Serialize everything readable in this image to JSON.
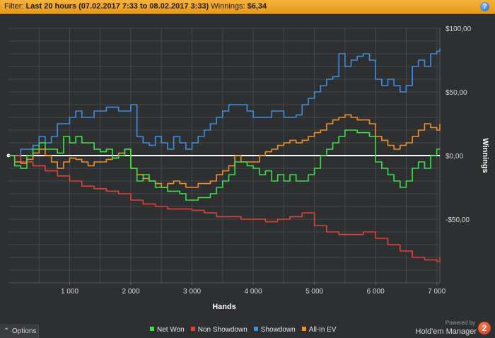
{
  "filter": {
    "prefix": "Filter:",
    "range": "Last 20 hours (07.02.2017 7:33 to 08.02.2017 3:33)",
    "winnings_label": "Winnings:",
    "winnings_value": "$6,34",
    "help_glyph": "?"
  },
  "options": {
    "glyph": "⌃",
    "label": "Options"
  },
  "branding": {
    "powered_by": "Powered by",
    "name": "Hold'em Manager",
    "logo_text": "2"
  },
  "colors": {
    "background": "#2e2f31",
    "grid": "#46474b",
    "filter_bar": "#f2a62d",
    "net_won": "#3ee04a",
    "non_showdown": "#e0413b",
    "showdown": "#3d8fe0",
    "all_in_ev": "#f0902a"
  },
  "chart_data": {
    "type": "line",
    "xlabel": "Hands",
    "ylabel": "Winnings",
    "xlim": [
      0,
      7050
    ],
    "ylim": [
      -100,
      100
    ],
    "x_ticks": [
      1000,
      2000,
      3000,
      4000,
      5000,
      6000,
      7000
    ],
    "x_tick_labels": [
      "1 000",
      "2 000",
      "3 000",
      "4 000",
      "5 000",
      "6 000",
      "7 000"
    ],
    "y_ticks": [
      100,
      50,
      0,
      -50
    ],
    "y_tick_labels": [
      "$100,00",
      "$50,00",
      "$0,00",
      "-$50,00"
    ],
    "zero_line": true,
    "grid": true,
    "legend_position": "bottom",
    "series": [
      {
        "name": "Net Won",
        "color": "#3ee04a",
        "x": [
          0,
          100,
          200,
          300,
          400,
          500,
          600,
          700,
          800,
          900,
          1000,
          1100,
          1200,
          1300,
          1400,
          1500,
          1600,
          1700,
          1800,
          1900,
          2000,
          2100,
          2200,
          2300,
          2400,
          2500,
          2600,
          2700,
          2800,
          2900,
          3000,
          3100,
          3200,
          3300,
          3400,
          3500,
          3600,
          3700,
          3800,
          3900,
          4000,
          4100,
          4200,
          4300,
          4400,
          4500,
          4600,
          4700,
          4800,
          4900,
          5000,
          5100,
          5200,
          5300,
          5400,
          5500,
          5600,
          5700,
          5800,
          5900,
          6000,
          6100,
          6200,
          6300,
          6400,
          6500,
          6600,
          6700,
          6800,
          6900,
          7000,
          7050
        ],
        "y": [
          0,
          -8,
          -10,
          0,
          5,
          10,
          5,
          5,
          2,
          15,
          10,
          15,
          10,
          10,
          5,
          3,
          5,
          -2,
          0,
          5,
          -10,
          -20,
          -15,
          -20,
          -25,
          -25,
          -28,
          -28,
          -30,
          -35,
          -35,
          -33,
          -33,
          -30,
          -25,
          -20,
          -15,
          -5,
          -5,
          -8,
          -10,
          -15,
          -12,
          -20,
          -15,
          -20,
          -15,
          -20,
          -20,
          -15,
          -10,
          0,
          5,
          10,
          15,
          20,
          20,
          18,
          18,
          15,
          -5,
          -10,
          -15,
          -20,
          -25,
          -20,
          -10,
          -5,
          -10,
          0,
          5,
          5
        ]
      },
      {
        "name": "Non Showdown",
        "color": "#e0413b",
        "x": [
          0,
          200,
          400,
          600,
          800,
          1000,
          1200,
          1400,
          1600,
          1800,
          2000,
          2200,
          2400,
          2600,
          2800,
          3000,
          3200,
          3400,
          3600,
          3800,
          4000,
          4200,
          4400,
          4600,
          4800,
          5000,
          5200,
          5400,
          5600,
          5800,
          6000,
          6200,
          6400,
          6600,
          6800,
          7000,
          7050
        ],
        "y": [
          0,
          -5,
          -8,
          -12,
          -16,
          -20,
          -24,
          -26,
          -28,
          -30,
          -35,
          -38,
          -40,
          -42,
          -42,
          -43,
          -45,
          -48,
          -48,
          -50,
          -50,
          -52,
          -50,
          -48,
          -45,
          -55,
          -60,
          -62,
          -62,
          -60,
          -65,
          -70,
          -75,
          -80,
          -82,
          -83,
          -80
        ]
      },
      {
        "name": "Showdown",
        "color": "#3d8fe0",
        "x": [
          0,
          200,
          400,
          500,
          600,
          700,
          800,
          900,
          1000,
          1100,
          1200,
          1300,
          1400,
          1500,
          1600,
          1700,
          1800,
          1900,
          2000,
          2100,
          2200,
          2300,
          2400,
          2500,
          2600,
          2700,
          2800,
          2900,
          3000,
          3100,
          3200,
          3300,
          3400,
          3500,
          3600,
          3700,
          3800,
          3900,
          4000,
          4100,
          4200,
          4300,
          4400,
          4500,
          4600,
          4700,
          4800,
          4900,
          5000,
          5100,
          5200,
          5300,
          5400,
          5500,
          5600,
          5700,
          5800,
          5900,
          6000,
          6100,
          6200,
          6300,
          6400,
          6500,
          6600,
          6700,
          6800,
          6900,
          7000,
          7050
        ],
        "y": [
          0,
          5,
          8,
          15,
          10,
          15,
          25,
          25,
          30,
          35,
          30,
          30,
          35,
          35,
          38,
          38,
          35,
          35,
          40,
          15,
          10,
          8,
          15,
          10,
          5,
          15,
          10,
          5,
          10,
          15,
          20,
          25,
          30,
          35,
          40,
          40,
          40,
          35,
          30,
          30,
          30,
          35,
          35,
          30,
          30,
          32,
          40,
          45,
          50,
          55,
          60,
          62,
          80,
          70,
          75,
          78,
          80,
          75,
          60,
          55,
          60,
          55,
          50,
          55,
          70,
          75,
          70,
          80,
          82,
          84
        ]
      },
      {
        "name": "All-In EV",
        "color": "#f0902a",
        "x": [
          0,
          100,
          200,
          300,
          400,
          500,
          600,
          700,
          800,
          900,
          1000,
          1100,
          1200,
          1300,
          1400,
          1500,
          1600,
          1700,
          1800,
          1900,
          2000,
          2100,
          2200,
          2300,
          2400,
          2500,
          2600,
          2700,
          2800,
          2900,
          3000,
          3100,
          3200,
          3300,
          3400,
          3500,
          3600,
          3700,
          3800,
          3900,
          4000,
          4100,
          4200,
          4300,
          4400,
          4500,
          4600,
          4700,
          4800,
          4900,
          5000,
          5100,
          5200,
          5300,
          5400,
          5500,
          5600,
          5700,
          5800,
          5900,
          6000,
          6100,
          6200,
          6300,
          6400,
          6500,
          6600,
          6700,
          6800,
          6900,
          7000,
          7050
        ],
        "y": [
          0,
          -5,
          -6,
          -3,
          2,
          5,
          0,
          -5,
          -10,
          -5,
          -2,
          -3,
          -5,
          -8,
          -5,
          -5,
          -3,
          -2,
          2,
          5,
          -10,
          -15,
          -18,
          -20,
          -22,
          -25,
          -22,
          -20,
          -22,
          -25,
          -25,
          -22,
          -22,
          -20,
          -15,
          -12,
          -8,
          0,
          -5,
          -5,
          -5,
          0,
          3,
          5,
          8,
          10,
          12,
          10,
          12,
          15,
          18,
          20,
          25,
          28,
          30,
          32,
          30,
          28,
          28,
          25,
          15,
          12,
          8,
          5,
          8,
          10,
          15,
          20,
          25,
          22,
          20,
          25
        ]
      }
    ]
  }
}
